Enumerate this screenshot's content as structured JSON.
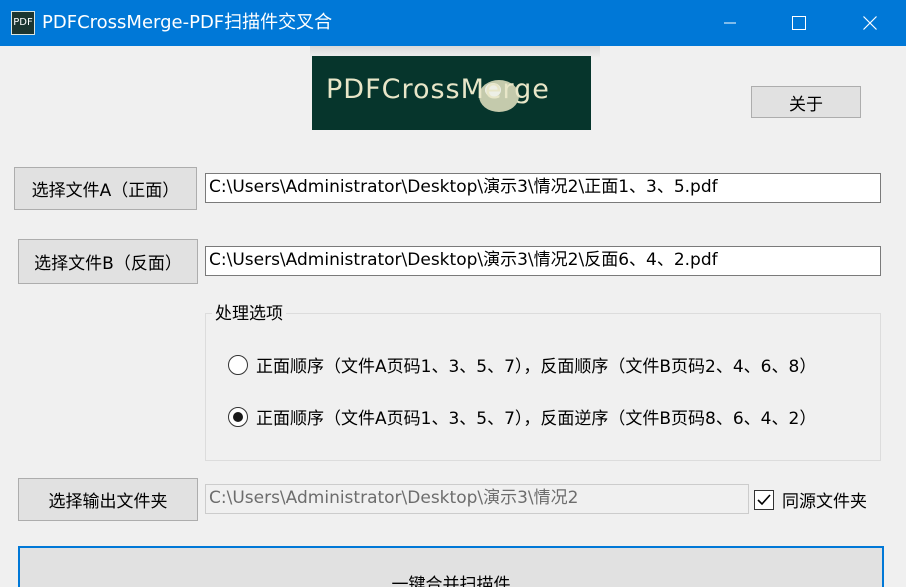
{
  "window": {
    "app_icon_text": "PDF",
    "title": "PDFCrossMerge-PDF扫描件交叉合"
  },
  "logo": {
    "text": "PDFCrossMerge"
  },
  "about_button": "关于",
  "file_a": {
    "button_label": "选择文件A（正面）",
    "path": "C:\\Users\\Administrator\\Desktop\\演示3\\情况2\\正面1、3、5.pdf"
  },
  "file_b": {
    "button_label": "选择文件B（反面）",
    "path": "C:\\Users\\Administrator\\Desktop\\演示3\\情况2\\反面6、4、2.pdf"
  },
  "options": {
    "group_title": "处理选项",
    "radios": [
      {
        "label": "正面顺序（文件A页码1、3、5、7），反面顺序（文件B页码2、4、6、8）",
        "checked": false
      },
      {
        "label": "正面顺序（文件A页码1、3、5、7），反面逆序（文件B页码8、6、4、2）",
        "checked": true
      }
    ]
  },
  "output": {
    "button_label": "选择输出文件夹",
    "path": "C:\\Users\\Administrator\\Desktop\\演示3\\情况2",
    "same_folder_label": "同源文件夹",
    "same_folder_checked": true
  },
  "merge_button": "一键合并扫描件",
  "colors": {
    "titlebar": "#0078d7",
    "logo_bg": "#06352c",
    "logo_text": "#e8e6c8",
    "focus_border": "#0078d7"
  }
}
